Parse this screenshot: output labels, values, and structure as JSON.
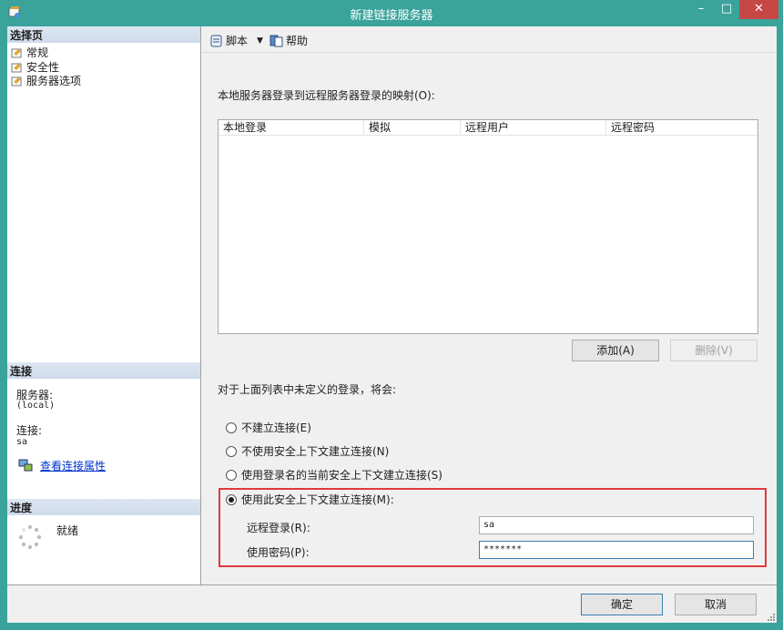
{
  "window": {
    "title": "新建链接服务器",
    "controls": {
      "minimize": "–",
      "maximize": "□",
      "close": "✕"
    }
  },
  "left_pane": {
    "select_page_header": "选择页",
    "pages": [
      {
        "label": "常规",
        "icon": "page-icon"
      },
      {
        "label": "安全性",
        "icon": "page-icon"
      },
      {
        "label": "服务器选项",
        "icon": "page-icon"
      }
    ],
    "connection_header": "连接",
    "server_label": "服务器:",
    "server_value": "(local)",
    "connection_label": "连接:",
    "connection_value": "sa",
    "view_connection_properties": "查看连接属性",
    "progress_header": "进度",
    "progress_status": "就绪"
  },
  "toolbar": {
    "script_label": "脚本",
    "help_label": "帮助"
  },
  "mapping": {
    "title": "本地服务器登录到远程服务器登录的映射(O):",
    "columns": [
      "本地登录",
      "模拟",
      "远程用户",
      "远程密码"
    ],
    "rows": [],
    "add_button": "添加(A)",
    "remove_button": "删除(V)"
  },
  "undefined_logins": {
    "label": "对于上面列表中未定义的登录，将会:",
    "options": [
      {
        "label": "不建立连接(E)",
        "selected": false
      },
      {
        "label": "不使用安全上下文建立连接(N)",
        "selected": false
      },
      {
        "label": "使用登录名的当前安全上下文建立连接(S)",
        "selected": false
      },
      {
        "label": "使用此安全上下文建立连接(M):",
        "selected": true
      }
    ],
    "remote_login_label": "远程登录(R):",
    "remote_login_value": "sa",
    "password_label": "使用密码(P):",
    "password_value": "*******"
  },
  "footer": {
    "ok_button": "确定",
    "cancel_button": "取消"
  },
  "colors": {
    "title_bar": "#3aa39b",
    "close_button": "#c74646",
    "highlight_border": "#e0393e",
    "link": "#0033cc"
  }
}
